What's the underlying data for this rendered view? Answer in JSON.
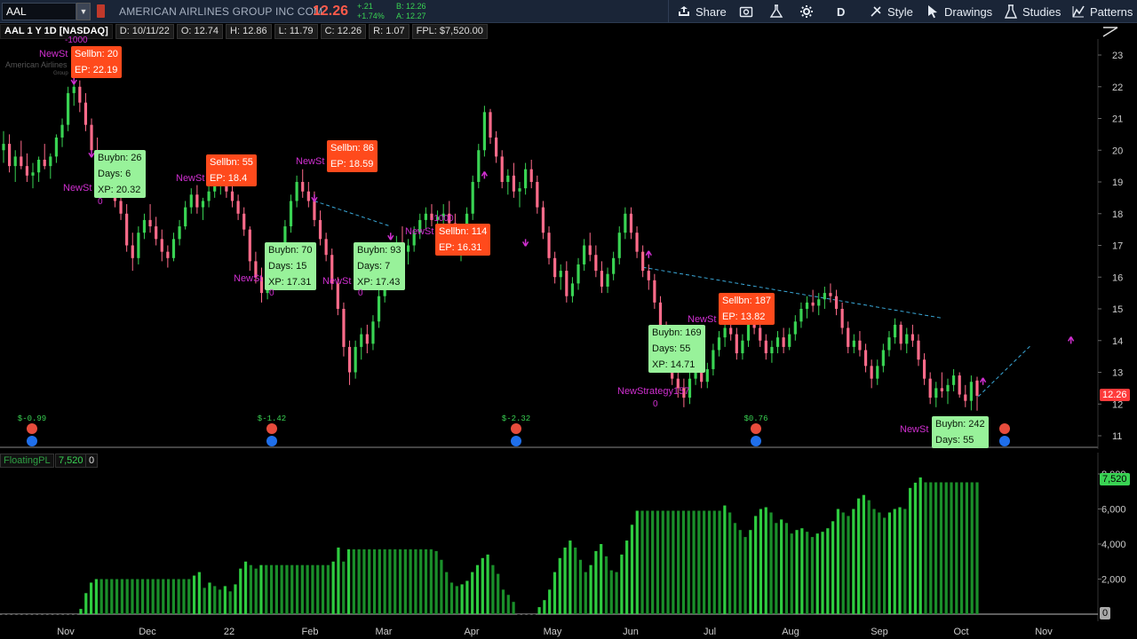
{
  "toolbar": {
    "symbol": "AAL",
    "company": "AMERICAN AIRLINES GROUP INC COM",
    "last": "12.26",
    "net_change": "+.21",
    "pct_change": "+1.74%",
    "bid": "B: 12.26",
    "ask": "A: 12.27",
    "share": "Share",
    "period": "D",
    "style": "Style",
    "drawings": "Drawings",
    "studies": "Studies",
    "patterns": "Patterns"
  },
  "infobar": {
    "title": "AAL 1 Y 1D [NASDAQ]",
    "date": "D: 10/11/22",
    "open": "O: 12.74",
    "high": "H: 12.86",
    "low": "L: 11.79",
    "close": "C: 12.26",
    "range": "R: 1.07",
    "fpl": "FPL: $7,520.00"
  },
  "watermark": {
    "name": "American Airlines",
    "sub": "Group"
  },
  "price_axis": {
    "ticks": [
      "23",
      "22",
      "21",
      "20",
      "19",
      "18",
      "17",
      "16",
      "15",
      "14",
      "13",
      "12",
      "11"
    ],
    "last_tag": "12.26"
  },
  "indicator": {
    "name": "FloatingPL",
    "value": "7,520",
    "zero": "0",
    "ticks": [
      "8,000",
      "6,000",
      "4,000",
      "2,000"
    ],
    "zero_tag": "0",
    "value_tag": "7,520"
  },
  "x_axis": {
    "months": [
      "Nov",
      "Dec",
      "22",
      "Feb",
      "Mar",
      "Apr",
      "May",
      "Jun",
      "Jul",
      "Aug",
      "Sep",
      "Oct",
      "Nov"
    ]
  },
  "trade_labels": [
    {
      "type": "sell",
      "text": [
        "Sellbn: 20",
        "EP: 22.19"
      ]
    },
    {
      "type": "buy",
      "text": [
        "Buybn: 26",
        "Days: 6",
        "XP: 20.32"
      ]
    },
    {
      "type": "sell",
      "text": [
        "Sellbn: 55",
        "EP: 18.4"
      ]
    },
    {
      "type": "buy",
      "text": [
        "Buybn: 70",
        "Days: 15",
        "XP: 17.31"
      ]
    },
    {
      "type": "sell",
      "text": [
        "Sellbn: 86",
        "EP: 18.59"
      ]
    },
    {
      "type": "buy",
      "text": [
        "Buybn: 93",
        "Days: 7",
        "XP: 17.43"
      ]
    },
    {
      "type": "sell",
      "text": [
        "Sellbn: 114",
        "EP: 16.31"
      ]
    },
    {
      "type": "buy",
      "text": [
        "Buybn: 169",
        "Days: 55",
        "XP: 14.71"
      ]
    },
    {
      "type": "sell",
      "text": [
        "Sellbn: 187",
        "EP: 13.82"
      ]
    },
    {
      "type": "buy",
      "text": [
        "Buybn: 242",
        "Days: 55"
      ]
    }
  ],
  "strategy_tags": [
    {
      "text": "NewSt",
      "qty": "-1000"
    },
    {
      "text": "NewSt",
      "qty": "0"
    },
    {
      "text": "NewSt",
      "qty": ""
    },
    {
      "text": "NewSt",
      "qty": "0"
    },
    {
      "text": "NewSt",
      "qty": ""
    },
    {
      "text": "NewSt",
      "qty": "0"
    },
    {
      "text": "NewSt",
      "qty": "-1000"
    },
    {
      "text": "NewStrategy157",
      "qty": "0"
    },
    {
      "text": "NewSt",
      "qty": ""
    },
    {
      "text": "NewSt",
      "qty": ""
    }
  ],
  "earnings": [
    "$-0.99",
    "$-1.42",
    "$-2.32",
    "$0.76"
  ],
  "colors": {
    "up": "#39d353",
    "down": "#ff6b8a",
    "sell": "#ff4a1c",
    "buy": "#98f29a",
    "strategy": "#d02fd0",
    "toolbar": "#1a2537"
  },
  "chart_data": {
    "type": "candlestick",
    "price_range": [
      10.8,
      23.4
    ],
    "ohlc": [
      [
        20.0,
        20.6,
        19.6,
        20.2
      ],
      [
        20.2,
        20.5,
        19.3,
        19.5
      ],
      [
        19.5,
        20.0,
        19.0,
        19.8
      ],
      [
        19.8,
        20.3,
        19.4,
        19.5
      ],
      [
        19.5,
        19.9,
        19.0,
        19.2
      ],
      [
        19.2,
        19.6,
        18.8,
        19.3
      ],
      [
        19.3,
        19.8,
        19.0,
        19.7
      ],
      [
        19.7,
        20.2,
        19.4,
        19.5
      ],
      [
        19.5,
        19.9,
        19.1,
        19.8
      ],
      [
        19.8,
        20.5,
        19.6,
        20.4
      ],
      [
        20.4,
        21.0,
        20.1,
        20.8
      ],
      [
        20.8,
        22.0,
        20.6,
        21.8
      ],
      [
        21.8,
        22.4,
        21.4,
        22.0
      ],
      [
        22.0,
        22.2,
        21.2,
        21.5
      ],
      [
        21.5,
        21.8,
        20.6,
        20.8
      ],
      [
        20.8,
        21.0,
        19.8,
        20.0
      ],
      [
        20.0,
        20.4,
        19.3,
        19.6
      ],
      [
        19.6,
        20.0,
        19.0,
        19.5
      ],
      [
        19.5,
        19.8,
        18.6,
        18.8
      ],
      [
        18.8,
        19.1,
        18.2,
        18.4
      ],
      [
        18.4,
        18.8,
        17.8,
        18.0
      ],
      [
        18.0,
        18.3,
        16.8,
        17.0
      ],
      [
        17.0,
        17.4,
        16.2,
        16.6
      ],
      [
        16.6,
        17.6,
        16.4,
        17.4
      ],
      [
        17.4,
        18.0,
        17.2,
        17.8
      ],
      [
        17.8,
        18.3,
        17.4,
        17.6
      ],
      [
        17.6,
        17.9,
        17.0,
        17.2
      ],
      [
        17.2,
        17.5,
        16.5,
        16.8
      ],
      [
        16.8,
        17.0,
        16.3,
        16.6
      ],
      [
        16.6,
        17.4,
        16.5,
        17.2
      ],
      [
        17.2,
        17.8,
        17.0,
        17.6
      ],
      [
        17.6,
        18.4,
        17.5,
        18.2
      ],
      [
        18.2,
        18.8,
        18.0,
        18.6
      ],
      [
        18.6,
        18.9,
        18.0,
        18.2
      ],
      [
        18.2,
        18.5,
        17.8,
        18.4
      ],
      [
        18.4,
        18.9,
        18.2,
        18.7
      ],
      [
        18.7,
        19.1,
        18.5,
        18.9
      ],
      [
        18.9,
        19.2,
        18.6,
        19.0
      ],
      [
        19.0,
        19.2,
        18.5,
        18.7
      ],
      [
        18.7,
        18.9,
        18.2,
        18.4
      ],
      [
        18.4,
        18.6,
        17.8,
        18.0
      ],
      [
        18.0,
        18.2,
        17.3,
        17.5
      ],
      [
        17.5,
        17.6,
        16.2,
        16.5
      ],
      [
        16.5,
        16.8,
        15.8,
        16.0
      ],
      [
        16.0,
        16.3,
        15.2,
        15.5
      ],
      [
        15.5,
        16.0,
        15.3,
        15.8
      ],
      [
        15.8,
        16.5,
        15.6,
        16.3
      ],
      [
        16.3,
        17.0,
        16.0,
        16.8
      ],
      [
        16.8,
        17.8,
        16.6,
        17.6
      ],
      [
        17.6,
        18.6,
        17.4,
        18.4
      ],
      [
        18.4,
        19.2,
        18.2,
        19.0
      ],
      [
        19.0,
        19.4,
        18.5,
        18.7
      ],
      [
        18.7,
        19.0,
        18.2,
        18.4
      ],
      [
        18.4,
        18.7,
        17.6,
        17.8
      ],
      [
        17.8,
        18.1,
        17.0,
        17.2
      ],
      [
        17.2,
        17.4,
        16.5,
        16.7
      ],
      [
        16.7,
        16.9,
        15.6,
        15.8
      ],
      [
        15.8,
        16.0,
        14.8,
        15.0
      ],
      [
        15.0,
        15.2,
        13.5,
        13.8
      ],
      [
        13.8,
        14.0,
        12.6,
        13.0
      ],
      [
        13.0,
        14.0,
        12.8,
        13.8
      ],
      [
        13.8,
        14.4,
        13.4,
        14.2
      ],
      [
        14.2,
        14.5,
        13.6,
        13.9
      ],
      [
        13.9,
        14.8,
        13.7,
        14.6
      ],
      [
        14.6,
        15.6,
        14.4,
        15.4
      ],
      [
        15.4,
        16.3,
        15.2,
        16.1
      ],
      [
        16.1,
        16.8,
        15.8,
        16.6
      ],
      [
        16.6,
        17.3,
        16.4,
        17.1
      ],
      [
        17.1,
        17.6,
        16.6,
        16.8
      ],
      [
        16.8,
        17.2,
        16.4,
        17.0
      ],
      [
        17.0,
        17.6,
        16.8,
        17.4
      ],
      [
        17.4,
        18.0,
        17.2,
        17.8
      ],
      [
        17.8,
        18.2,
        17.5,
        18.0
      ],
      [
        18.0,
        18.3,
        17.6,
        17.8
      ],
      [
        17.8,
        18.1,
        17.4,
        17.9
      ],
      [
        17.9,
        18.3,
        17.6,
        18.0
      ],
      [
        18.0,
        18.4,
        17.5,
        17.7
      ],
      [
        17.7,
        18.0,
        16.9,
        17.1
      ],
      [
        17.1,
        17.4,
        16.5,
        17.2
      ],
      [
        17.2,
        18.2,
        17.0,
        18.0
      ],
      [
        18.0,
        19.2,
        17.8,
        19.0
      ],
      [
        19.0,
        20.2,
        18.8,
        20.0
      ],
      [
        20.0,
        21.4,
        19.8,
        21.2
      ],
      [
        21.2,
        21.3,
        20.2,
        20.4
      ],
      [
        20.4,
        20.6,
        19.6,
        19.8
      ],
      [
        19.8,
        20.0,
        18.8,
        19.0
      ],
      [
        19.0,
        19.4,
        18.6,
        19.2
      ],
      [
        19.2,
        19.6,
        18.5,
        18.7
      ],
      [
        18.7,
        19.0,
        18.2,
        18.8
      ],
      [
        18.8,
        19.6,
        18.6,
        19.4
      ],
      [
        19.4,
        19.7,
        18.8,
        19.0
      ],
      [
        19.0,
        19.2,
        18.0,
        18.2
      ],
      [
        18.2,
        18.4,
        17.2,
        17.4
      ],
      [
        17.4,
        17.6,
        16.4,
        16.6
      ],
      [
        16.6,
        16.8,
        15.8,
        16.0
      ],
      [
        16.0,
        16.4,
        15.6,
        16.2
      ],
      [
        16.2,
        16.5,
        15.2,
        15.4
      ],
      [
        15.4,
        16.0,
        15.2,
        15.8
      ],
      [
        15.8,
        16.6,
        15.6,
        16.4
      ],
      [
        16.4,
        17.2,
        16.2,
        17.0
      ],
      [
        17.0,
        17.4,
        16.5,
        16.7
      ],
      [
        16.7,
        17.0,
        16.0,
        16.2
      ],
      [
        16.2,
        16.5,
        15.5,
        15.7
      ],
      [
        15.7,
        16.3,
        15.5,
        16.1
      ],
      [
        16.1,
        16.8,
        15.9,
        16.6
      ],
      [
        16.6,
        17.6,
        16.4,
        17.4
      ],
      [
        17.4,
        18.2,
        17.2,
        18.0
      ],
      [
        18.0,
        18.2,
        17.2,
        17.4
      ],
      [
        17.4,
        17.6,
        16.6,
        16.8
      ],
      [
        16.8,
        17.0,
        16.0,
        16.2
      ],
      [
        16.2,
        16.4,
        15.6,
        15.9
      ],
      [
        15.9,
        16.1,
        15.0,
        15.2
      ],
      [
        15.2,
        15.4,
        14.2,
        14.4
      ],
      [
        14.4,
        14.6,
        13.4,
        13.6
      ],
      [
        13.6,
        13.8,
        12.6,
        12.8
      ],
      [
        12.8,
        13.2,
        12.2,
        12.5
      ],
      [
        12.5,
        12.8,
        11.9,
        12.2
      ],
      [
        12.2,
        13.0,
        12.0,
        12.8
      ],
      [
        12.8,
        13.4,
        12.6,
        13.2
      ],
      [
        13.2,
        13.4,
        12.5,
        12.7
      ],
      [
        12.7,
        13.3,
        12.5,
        13.1
      ],
      [
        13.1,
        13.9,
        12.9,
        13.7
      ],
      [
        13.7,
        14.3,
        13.5,
        14.1
      ],
      [
        14.1,
        14.6,
        13.8,
        14.4
      ],
      [
        14.4,
        14.8,
        14.0,
        14.2
      ],
      [
        14.2,
        14.4,
        13.4,
        13.6
      ],
      [
        13.6,
        14.2,
        13.4,
        14.0
      ],
      [
        14.0,
        14.8,
        13.8,
        14.6
      ],
      [
        14.6,
        15.0,
        14.2,
        14.4
      ],
      [
        14.4,
        14.6,
        13.8,
        14.0
      ],
      [
        14.0,
        14.2,
        13.4,
        13.6
      ],
      [
        13.6,
        14.0,
        13.3,
        13.8
      ],
      [
        13.8,
        14.3,
        13.6,
        14.1
      ],
      [
        14.1,
        14.4,
        13.6,
        13.8
      ],
      [
        13.8,
        14.4,
        13.7,
        14.2
      ],
      [
        14.2,
        14.8,
        14.0,
        14.6
      ],
      [
        14.6,
        15.2,
        14.4,
        15.0
      ],
      [
        15.0,
        15.4,
        14.7,
        15.2
      ],
      [
        15.2,
        15.6,
        14.9,
        15.1
      ],
      [
        15.1,
        15.5,
        14.8,
        15.3
      ],
      [
        15.3,
        15.7,
        15.0,
        15.5
      ],
      [
        15.5,
        15.8,
        15.2,
        15.4
      ],
      [
        15.4,
        15.6,
        14.8,
        15.0
      ],
      [
        15.0,
        15.2,
        14.2,
        14.4
      ],
      [
        14.4,
        14.6,
        13.6,
        13.8
      ],
      [
        13.8,
        14.2,
        13.6,
        14.0
      ],
      [
        14.0,
        14.3,
        13.5,
        13.7
      ],
      [
        13.7,
        13.9,
        13.0,
        13.2
      ],
      [
        13.2,
        13.4,
        12.5,
        12.8
      ],
      [
        12.8,
        13.4,
        12.6,
        13.2
      ],
      [
        13.2,
        13.9,
        13.0,
        13.7
      ],
      [
        13.7,
        14.3,
        13.5,
        14.1
      ],
      [
        14.1,
        14.7,
        13.9,
        14.5
      ],
      [
        14.5,
        14.6,
        13.7,
        13.9
      ],
      [
        13.9,
        14.4,
        13.6,
        14.2
      ],
      [
        14.2,
        14.5,
        13.8,
        14.0
      ],
      [
        14.0,
        14.2,
        13.2,
        13.4
      ],
      [
        13.4,
        13.6,
        12.6,
        12.8
      ],
      [
        12.8,
        13.0,
        12.0,
        12.2
      ],
      [
        12.2,
        12.7,
        11.9,
        12.5
      ],
      [
        12.5,
        13.0,
        12.2,
        12.4
      ],
      [
        12.4,
        12.8,
        12.0,
        12.6
      ],
      [
        12.6,
        13.1,
        12.4,
        12.9
      ],
      [
        12.9,
        13.0,
        12.2,
        12.3
      ],
      [
        12.3,
        12.6,
        11.9,
        12.1
      ],
      [
        12.1,
        12.9,
        11.8,
        12.7
      ],
      [
        12.74,
        12.86,
        11.79,
        12.26
      ]
    ],
    "floating_pl": [
      0,
      0,
      0,
      0,
      0,
      0,
      0,
      0,
      0,
      0,
      0,
      0,
      0,
      0,
      0,
      300,
      1200,
      1800,
      2000,
      2000,
      2000,
      2000,
      2000,
      2000,
      2000,
      2000,
      2000,
      2000,
      2000,
      2000,
      2000,
      2000,
      2000,
      2000,
      2000,
      2000,
      2000,
      2200,
      2400,
      1500,
      1800,
      1600,
      1400,
      1600,
      1300,
      1700,
      2600,
      3000,
      2800,
      2600,
      2800,
      2800,
      2800,
      2800,
      2800,
      2800,
      2800,
      2800,
      2800,
      2800,
      2800,
      2800,
      2800,
      2800,
      3000,
      3800,
      3000,
      3700,
      3700,
      3700,
      3700,
      3700,
      3700,
      3700,
      3700,
      3700,
      3700,
      3700,
      3700,
      3700,
      3700,
      3700,
      3700,
      3700,
      3600,
      3100,
      2400,
      1800,
      1600,
      1700,
      1900,
      2400,
      2800,
      3200,
      3400,
      2800,
      2300,
      1400,
      1100,
      700,
      0,
      0,
      0,
      0,
      400,
      800,
      1400,
      2400,
      3200,
      3800,
      4200,
      3800,
      3100,
      2400,
      2800,
      3600,
      4000,
      3300,
      2500,
      2400,
      3400,
      4200,
      5100,
      5900,
      5900,
      5900,
      5900,
      5900,
      5900,
      5900,
      5900,
      5900,
      5900,
      5900,
      5900,
      5900,
      5900,
      5900,
      5900,
      5900,
      6200,
      5800,
      5200,
      4800,
      4400,
      4800,
      5600,
      6000,
      6100,
      5800,
      5200,
      5400,
      5200,
      4600,
      4800,
      4900,
      4700,
      4400,
      4600,
      4700,
      4900,
      5300,
      6000,
      5800,
      5600,
      6000,
      6600,
      6800,
      6500,
      6000,
      5800,
      5500,
      5800,
      6000,
      6100,
      6000,
      7200,
      7500,
      7800,
      7520,
      7520,
      7520,
      7520,
      7520,
      7520,
      7520,
      7520,
      7520,
      7520,
      7520
    ],
    "pl_range": [
      -200,
      8000
    ]
  }
}
